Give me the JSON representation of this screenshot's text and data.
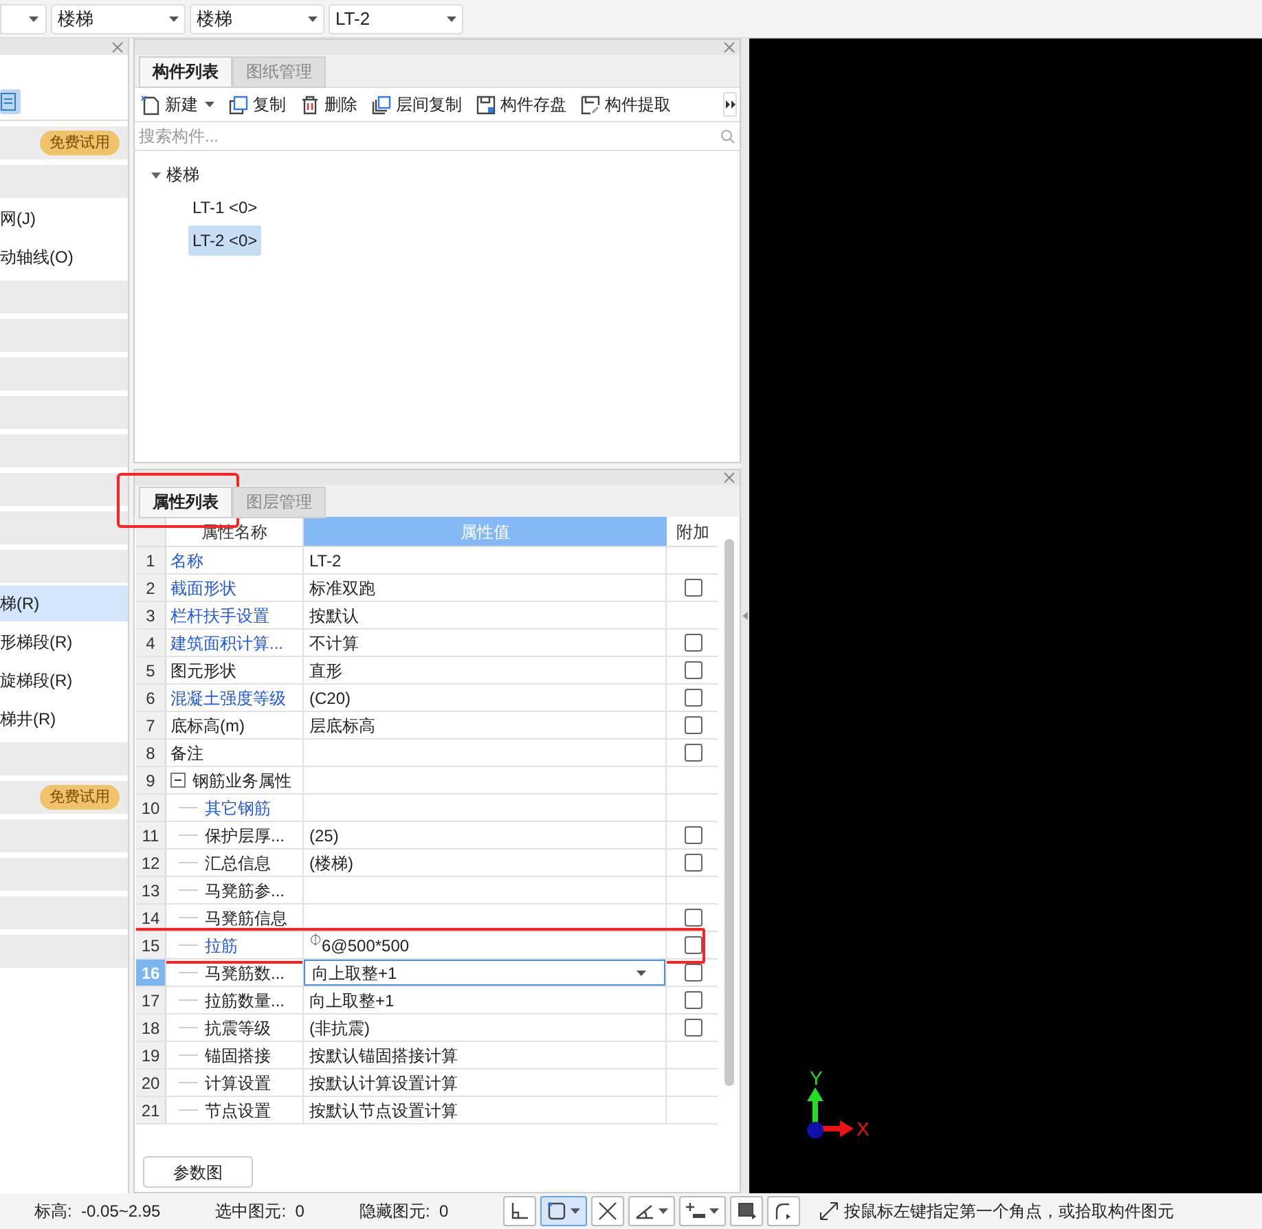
{
  "top_bar": {
    "dropdowns": [
      {
        "value": "楼梯"
      },
      {
        "value": "楼梯"
      },
      {
        "value": "LT-2"
      }
    ]
  },
  "left_panel": {
    "items": [
      {
        "kind": "icon_row"
      },
      {
        "kind": "badge_bar",
        "badge": "免费试用"
      },
      {
        "kind": "bar"
      },
      {
        "kind": "item",
        "label": "网(J)",
        "selected": false
      },
      {
        "kind": "item",
        "label": "动轴线(O)",
        "selected": false
      },
      {
        "kind": "bar"
      },
      {
        "kind": "bar"
      },
      {
        "kind": "bar"
      },
      {
        "kind": "bar"
      },
      {
        "kind": "bar"
      },
      {
        "kind": "bar"
      },
      {
        "kind": "bar"
      },
      {
        "kind": "bar"
      },
      {
        "kind": "item",
        "label": "梯(R)",
        "selected": true
      },
      {
        "kind": "item",
        "label": "形梯段(R)",
        "selected": false
      },
      {
        "kind": "item",
        "label": "旋梯段(R)",
        "selected": false
      },
      {
        "kind": "item",
        "label": "梯井(R)",
        "selected": false
      },
      {
        "kind": "bar"
      },
      {
        "kind": "badge_bar",
        "badge": "免费试用"
      },
      {
        "kind": "bar"
      },
      {
        "kind": "bar"
      },
      {
        "kind": "bar"
      },
      {
        "kind": "bar"
      }
    ]
  },
  "component_panel": {
    "tabs": [
      {
        "label": "构件列表",
        "selected": true
      },
      {
        "label": "图纸管理",
        "selected": false
      }
    ],
    "toolbar": [
      {
        "kind": "new",
        "label": "新建",
        "dropdown": true
      },
      {
        "kind": "copy",
        "label": "复制",
        "dropdown": false
      },
      {
        "kind": "delete",
        "label": "删除",
        "dropdown": false
      },
      {
        "kind": "floor_copy",
        "label": "层间复制",
        "dropdown": false
      },
      {
        "kind": "save",
        "label": "构件存盘",
        "dropdown": false
      },
      {
        "kind": "extract",
        "label": "构件提取",
        "dropdown": false
      }
    ],
    "search": {
      "placeholder": "搜索构件..."
    },
    "tree": [
      {
        "label": "楼梯",
        "expanded": true,
        "children": [
          {
            "label": "LT-1 <0>",
            "selected": false
          },
          {
            "label": "LT-2 <0>",
            "selected": true
          }
        ]
      }
    ]
  },
  "property_panel": {
    "tabs": [
      {
        "label": "属性列表",
        "selected": true,
        "highlighted": true
      },
      {
        "label": "图层管理",
        "selected": false,
        "highlighted": false
      }
    ],
    "columns": [
      "属性名称",
      "属性值",
      "附加"
    ],
    "rows": [
      {
        "num": "1",
        "name": "名称",
        "value": "LT-2",
        "public": true
      },
      {
        "num": "2",
        "name": "截面形状",
        "value": "标准双跑",
        "public": true,
        "checked": false
      },
      {
        "num": "3",
        "name": "栏杆扶手设置",
        "value": "按默认",
        "public": true
      },
      {
        "num": "4",
        "name": "建筑面积计算...",
        "value": "不计算",
        "public": true,
        "checked": false
      },
      {
        "num": "5",
        "name": "图元形状",
        "value": "直形",
        "public": false,
        "checked": false
      },
      {
        "num": "6",
        "name": "混凝土强度等级",
        "value": "(C20)",
        "public": true,
        "checked": false
      },
      {
        "num": "7",
        "name": "底标高(m)",
        "value": "层底标高",
        "public": false,
        "checked": false
      },
      {
        "num": "8",
        "name": "备注",
        "public": false,
        "checked": false
      },
      {
        "num": "9",
        "name": "钢筋业务属性",
        "public": false,
        "expanded": true,
        "children": [
          {
            "num": "10",
            "name": "其它钢筋",
            "public": true
          },
          {
            "num": "11",
            "name": "保护层厚...",
            "value": "(25)",
            "public": false,
            "checked": false
          },
          {
            "num": "12",
            "name": "汇总信息",
            "value": "(楼梯)",
            "public": false,
            "checked": false
          },
          {
            "num": "13",
            "name": "马凳筋参...",
            "public": false
          },
          {
            "num": "14",
            "name": "马凳筋信息",
            "public": false,
            "checked": false
          },
          {
            "num": "15",
            "name": "拉筋",
            "value": "$^{⏀}$6@500*500",
            "public": true,
            "checked": false,
            "highlighted": true
          },
          {
            "num": "16",
            "name": "马凳筋数...",
            "value": "向上取整+1",
            "public": false,
            "checked": false,
            "selected": true
          },
          {
            "num": "17",
            "name": "拉筋数量...",
            "value": "向上取整+1",
            "public": false,
            "checked": false
          },
          {
            "num": "18",
            "name": "抗震等级",
            "value": "(非抗震)",
            "public": false,
            "checked": false
          },
          {
            "num": "19",
            "name": "锚固搭接",
            "value": "按默认锚固搭接计算",
            "public": false
          },
          {
            "num": "20",
            "name": "计算设置",
            "value": "按默认计算设置计算",
            "public": false
          },
          {
            "num": "21",
            "name": "节点设置",
            "value": "按默认节点设置计算",
            "public": false
          }
        ]
      }
    ],
    "button": "参数图"
  },
  "canvas": {
    "axis_x": "X",
    "axis_y": "Y"
  },
  "status_bar": {
    "fields": [
      {
        "label": "标高:",
        "value": "-0.05~2.95"
      },
      {
        "label": "选中图元:",
        "value": "0"
      },
      {
        "label": "隐藏图元:",
        "value": "0"
      }
    ],
    "tools": [
      {
        "kind": "corner",
        "selected": false,
        "dropdown": false
      },
      {
        "kind": "rect",
        "selected": true,
        "dropdown": true
      },
      {
        "kind": "cross",
        "selected": false,
        "dropdown": false
      },
      {
        "kind": "angle",
        "selected": false,
        "dropdown": true
      },
      {
        "kind": "plus_line",
        "selected": false,
        "dropdown": true
      },
      {
        "kind": "screen",
        "selected": false,
        "dropdown": false
      },
      {
        "kind": "arc",
        "selected": false,
        "dropdown": false
      }
    ],
    "hint": "按鼠标左键指定第一个角点，或拾取构件图元"
  }
}
